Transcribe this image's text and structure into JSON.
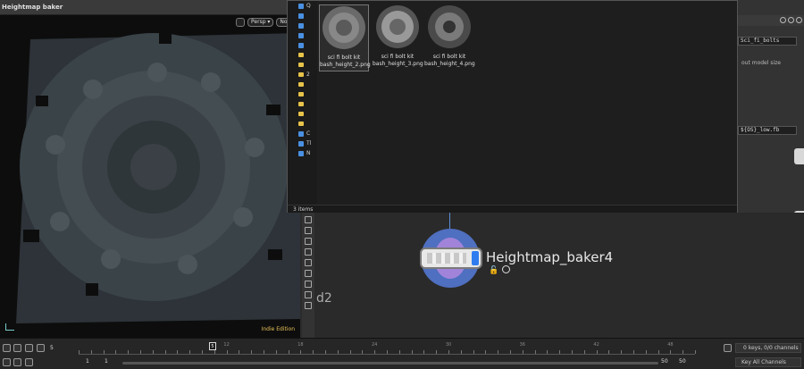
{
  "window": {
    "title": "Heightmap baker"
  },
  "viewport": {
    "persp_label": "Persp ▾",
    "cam_label": "No ca",
    "watermark": "Indie Edition"
  },
  "file_dialog": {
    "nav_items": [
      {
        "label": "Q",
        "icon": "star-icon"
      },
      {
        "label": "",
        "icon": "desktop-icon"
      },
      {
        "label": "",
        "icon": "download-icon"
      },
      {
        "label": "",
        "icon": "document-icon"
      },
      {
        "label": "",
        "icon": "image-icon"
      },
      {
        "label": "",
        "icon": "folder-icon"
      },
      {
        "label": "",
        "icon": "folder-icon"
      },
      {
        "label": "2",
        "icon": "folder-icon"
      },
      {
        "label": "",
        "icon": "folder-icon"
      },
      {
        "label": "",
        "icon": "folder-icon"
      },
      {
        "label": "",
        "icon": "folder-icon"
      },
      {
        "label": "",
        "icon": "folder-icon"
      },
      {
        "label": "",
        "icon": "folder-icon"
      },
      {
        "label": "C",
        "icon": "drive-icon"
      },
      {
        "label": "Tl",
        "icon": "computer-icon"
      },
      {
        "label": "N",
        "icon": "network-icon"
      }
    ],
    "files": [
      {
        "line1": "sci fi bolt kit",
        "line2": "bash_height_2.png"
      },
      {
        "line1": "sci fi bolt kit",
        "line2": "bash_height_3.png"
      },
      {
        "line1": "sci fi bolt kit",
        "line2": "bash_height_4.png"
      }
    ],
    "status": "3 items"
  },
  "right_panel": {
    "node_name_field": "Sci_fi_bolts",
    "hint": "out model size",
    "path_field": "${OS}_low.fb"
  },
  "network": {
    "node_label": "Heightmap_baker4",
    "partial_label": "d2"
  },
  "timeline": {
    "current_frame": "5",
    "playhead": "5",
    "ticks": [
      "12",
      "18",
      "24",
      "30",
      "36",
      "42",
      "48"
    ],
    "start": "1",
    "start2": "1",
    "end": "50",
    "end2": "50",
    "keys_label": "0 keys, 0/0 channels",
    "key_all": "Key All Channels"
  }
}
